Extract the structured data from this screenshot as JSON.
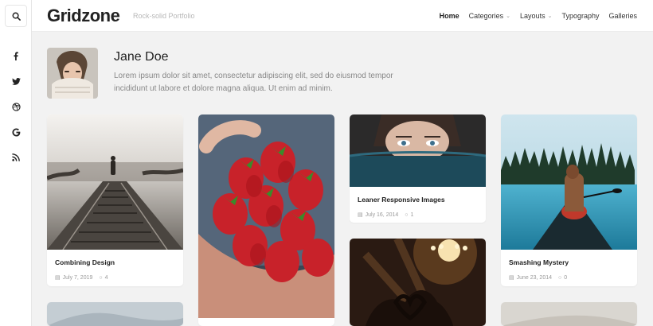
{
  "brand": {
    "logo": "Gridzone",
    "tagline": "Rock-solid Portfolio"
  },
  "nav": {
    "items": [
      {
        "label": "Home",
        "active": true,
        "dropdown": false
      },
      {
        "label": "Categories",
        "active": false,
        "dropdown": true
      },
      {
        "label": "Layouts",
        "active": false,
        "dropdown": true
      },
      {
        "label": "Typography",
        "active": false,
        "dropdown": false
      },
      {
        "label": "Galleries",
        "active": false,
        "dropdown": false
      }
    ]
  },
  "sidebar": {
    "search_icon": "search-icon",
    "social": [
      {
        "icon": "facebook-icon",
        "glyph": "f"
      },
      {
        "icon": "twitter-icon",
        "glyph": "t"
      },
      {
        "icon": "dribbble-icon",
        "glyph": "d"
      },
      {
        "icon": "google-icon",
        "glyph": "G"
      },
      {
        "icon": "rss-icon",
        "glyph": "r"
      }
    ]
  },
  "author": {
    "name": "Jane Doe",
    "bio": "Lorem ipsum dolor sit amet, consectetur adipiscing elit, sed do eiusmod tempor incididunt ut labore et dolore magna aliqua. Ut enim ad minim."
  },
  "posts": [
    {
      "title": "Combining Design",
      "date": "July 7, 2019",
      "comments": "4"
    },
    {
      "title": "Leaner Responsive Images",
      "date": "July 16, 2014",
      "comments": "1"
    },
    {
      "title": "Smashing Mystery",
      "date": "June 23, 2014",
      "comments": "0"
    }
  ],
  "colors": {
    "background": "#f2f2f2",
    "card": "#ffffff",
    "text": "#222222",
    "muted": "#999999"
  }
}
